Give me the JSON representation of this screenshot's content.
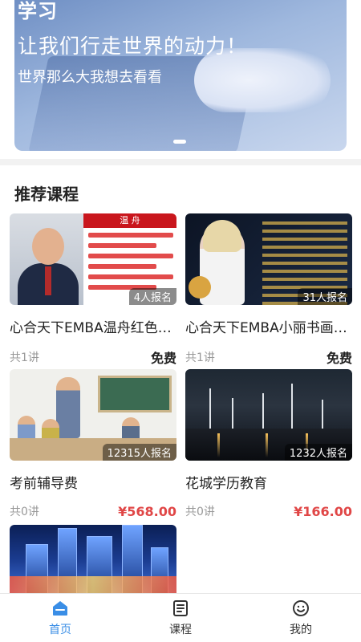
{
  "banner": {
    "title_top": "学习",
    "headline": "让我们行走世界的动力！",
    "subline": "世界那么大我想去看看"
  },
  "section": {
    "title": "推荐课程"
  },
  "thumbs": {
    "card1_header": "温 舟"
  },
  "courses": [
    {
      "title": "心合天下EMBA温舟红色…",
      "lessons": "共1讲",
      "price": "免费",
      "badge": "4人报名"
    },
    {
      "title": "心合天下EMBA小丽书画…",
      "lessons": "共1讲",
      "price": "免费",
      "badge": "31人报名"
    },
    {
      "title": "考前辅导费",
      "lessons": "共0讲",
      "price": "¥568.00",
      "badge": "12315人报名"
    },
    {
      "title": "花城学历教育",
      "lessons": "共0讲",
      "price": "¥166.00",
      "badge": "1232人报名"
    }
  ],
  "tabbar": {
    "items": [
      {
        "label": "首页",
        "icon": "home-icon",
        "active": true
      },
      {
        "label": "课程",
        "icon": "course-icon",
        "active": false
      },
      {
        "label": "我的",
        "icon": "profile-icon",
        "active": false
      }
    ]
  },
  "colors": {
    "accent": "#3a8ee6",
    "price": "#e04646"
  }
}
